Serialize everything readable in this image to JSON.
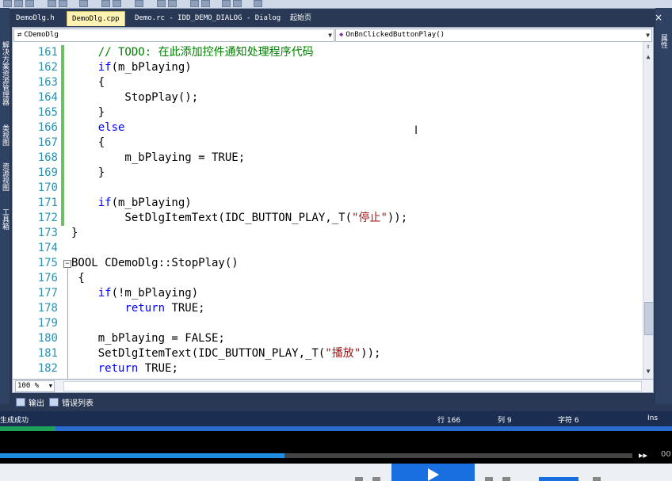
{
  "tabs": [
    {
      "label": "DemoDlg.h",
      "active": false
    },
    {
      "label": "DemoDlg.cpp",
      "active": true
    },
    {
      "label": "Demo.rc - IDD_DEMO_DIALOG - Dialog",
      "active": false
    },
    {
      "label": "起始页",
      "active": false
    }
  ],
  "nav": {
    "class_selector": "CDemoDlg",
    "member_selector": "OnBnClickedButtonPlay()"
  },
  "left_dock": [
    "解决方案资源管理器",
    "类视图",
    "资源视图",
    "工具箱"
  ],
  "right_dock": [
    "属性"
  ],
  "code": [
    {
      "n": "161",
      "text": "    // TODO: 在此添加控件通知处理程序代码"
    },
    {
      "n": "162",
      "text": "    if(m_bPlaying)"
    },
    {
      "n": "163",
      "text": "    {"
    },
    {
      "n": "164",
      "text": "        StopPlay();"
    },
    {
      "n": "165",
      "text": "    }"
    },
    {
      "n": "166",
      "text": "    else"
    },
    {
      "n": "167",
      "text": "    {"
    },
    {
      "n": "168",
      "text": "        m_bPlaying = TRUE;"
    },
    {
      "n": "169",
      "text": "    }"
    },
    {
      "n": "170",
      "text": ""
    },
    {
      "n": "171",
      "text": "    if(m_bPlaying)"
    },
    {
      "n": "172",
      "text": "        SetDlgItemText(IDC_BUTTON_PLAY,_T(\"停止\"));"
    },
    {
      "n": "173",
      "text": "}"
    },
    {
      "n": "174",
      "text": ""
    },
    {
      "n": "175",
      "text": "BOOL CDemoDlg::StopPlay()"
    },
    {
      "n": "176",
      "text": " {"
    },
    {
      "n": "177",
      "text": "    if(!m_bPlaying)"
    },
    {
      "n": "178",
      "text": "        return TRUE;"
    },
    {
      "n": "179",
      "text": ""
    },
    {
      "n": "180",
      "text": "    m_bPlaying = FALSE;"
    },
    {
      "n": "181",
      "text": "    SetDlgItemText(IDC_BUTTON_PLAY,_T(\"播放\"));"
    },
    {
      "n": "182",
      "text": "    return TRUE;"
    }
  ],
  "zoom": "100 %",
  "output_tabs": [
    "输出",
    "错误列表"
  ],
  "status": {
    "message": "生成成功",
    "line": "行 166",
    "col": "列 9",
    "char": "字符 6",
    "mode": "Ins"
  },
  "player": {
    "progress_fraction": 0.45,
    "time": "00"
  },
  "colors": {
    "keyword": "#0000ff",
    "comment": "#008000",
    "string": "#a31515",
    "line_number": "#2b91af",
    "change_marker": "#6ac063",
    "active_tab": "#fff3b4",
    "ide_background": "#293955",
    "play_button": "#1a6fe0"
  }
}
